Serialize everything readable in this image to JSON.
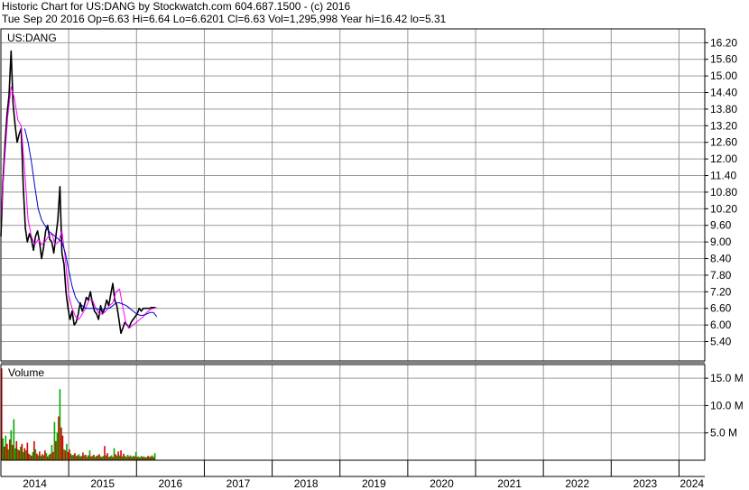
{
  "header": {
    "line1": "Historic Chart for US:DANG by Stockwatch.com 604.687.1500 - (c) 2016",
    "line2": "Tue Sep 20 2016  Op=6.63  Hi=6.64  Lo=6.6201  Cl=6.63  Vol=1,295,998  Year hi=16.42  lo=5.31"
  },
  "colors": {
    "price": "#000000",
    "ma_fast": "#ff00ff",
    "ma_slow": "#0000cc",
    "vol_up": "#00aa00",
    "vol_down": "#dd0000",
    "grid": "#999999"
  },
  "chart_data": [
    {
      "type": "line",
      "title": "US:DANG",
      "ylim": [
        4.7,
        16.7
      ],
      "yticks": [
        "16.20",
        "15.60",
        "15.00",
        "14.40",
        "13.80",
        "13.20",
        "12.60",
        "12.00",
        "11.40",
        "10.80",
        "10.20",
        "9.60",
        "9.00",
        "8.40",
        "7.80",
        "7.20",
        "6.60",
        "6.00",
        "5.40"
      ],
      "xlim": [
        2014.0,
        2024.38
      ],
      "x_labels": [
        {
          "x": 2014.0,
          "label": "2014"
        },
        {
          "x": 2015.0,
          "label": "2015"
        },
        {
          "x": 2016.0,
          "label": "2016"
        },
        {
          "x": 2017.0,
          "label": "2017"
        },
        {
          "x": 2018.0,
          "label": "2018"
        },
        {
          "x": 2019.0,
          "label": "2019"
        },
        {
          "x": 2020.0,
          "label": "2020"
        },
        {
          "x": 2021.0,
          "label": "2021"
        },
        {
          "x": 2022.0,
          "label": "2022"
        },
        {
          "x": 2023.0,
          "label": "2023"
        },
        {
          "x": 2024.0,
          "label": "2024"
        }
      ],
      "series": [
        {
          "key": "price",
          "x": [
            2014.0,
            2014.03,
            2014.06,
            2014.09,
            2014.12,
            2014.15,
            2014.18,
            2014.21,
            2014.24,
            2014.27,
            2014.3,
            2014.33,
            2014.36,
            2014.39,
            2014.42,
            2014.45,
            2014.48,
            2014.51,
            2014.54,
            2014.57,
            2014.6,
            2014.63,
            2014.66,
            2014.69,
            2014.72,
            2014.75,
            2014.78,
            2014.81,
            2014.84,
            2014.87,
            2014.9,
            2014.93,
            2014.96,
            2014.99,
            2015.02,
            2015.05,
            2015.08,
            2015.11,
            2015.14,
            2015.17,
            2015.2,
            2015.23,
            2015.26,
            2015.29,
            2015.32,
            2015.35,
            2015.38,
            2015.41,
            2015.44,
            2015.47,
            2015.5,
            2015.53,
            2015.56,
            2015.59,
            2015.62,
            2015.65,
            2015.68,
            2015.71,
            2015.74,
            2015.77,
            2015.8,
            2015.83,
            2015.86,
            2015.89,
            2015.92,
            2015.95,
            2015.98,
            2016.01,
            2016.04,
            2016.07,
            2016.1,
            2016.13,
            2016.16,
            2016.19,
            2016.22,
            2016.25,
            2016.28
          ],
          "y": [
            9.2,
            11.2,
            12.5,
            13.6,
            14.3,
            15.9,
            14.0,
            13.2,
            12.6,
            12.9,
            13.1,
            11.0,
            9.5,
            9.0,
            9.3,
            9.1,
            8.7,
            9.2,
            9.4,
            9.0,
            8.4,
            8.8,
            9.4,
            9.6,
            9.1,
            9.0,
            8.6,
            9.2,
            9.8,
            11.0,
            8.6,
            8.2,
            7.2,
            6.6,
            6.2,
            6.5,
            6.0,
            6.1,
            6.4,
            6.8,
            6.5,
            6.7,
            7.0,
            6.9,
            7.2,
            6.8,
            6.5,
            6.4,
            6.2,
            6.7,
            6.4,
            6.6,
            6.9,
            6.7,
            7.1,
            7.5,
            6.9,
            6.7,
            6.2,
            5.7,
            5.9,
            6.1,
            6.0,
            5.9,
            6.1,
            6.2,
            6.3,
            6.4,
            6.6,
            6.5,
            6.6,
            6.6,
            6.6,
            6.6,
            6.63,
            6.63,
            6.63
          ]
        },
        {
          "key": "ma_fast",
          "x": [
            2014.0,
            2014.05,
            2014.1,
            2014.15,
            2014.2,
            2014.25,
            2014.3,
            2014.35,
            2014.4,
            2014.45,
            2014.5,
            2014.55,
            2014.6,
            2014.65,
            2014.7,
            2014.75,
            2014.8,
            2014.85,
            2014.9,
            2014.95,
            2015.0,
            2015.05,
            2015.1,
            2015.15,
            2015.2,
            2015.25,
            2015.3,
            2015.35,
            2015.4,
            2015.45,
            2015.5,
            2015.55,
            2015.6,
            2015.65,
            2015.7,
            2015.75,
            2015.8,
            2015.85,
            2015.9,
            2015.95,
            2016.0,
            2016.05,
            2016.1,
            2016.15,
            2016.2,
            2016.25,
            2016.3
          ],
          "y": [
            9.8,
            11.8,
            13.5,
            14.6,
            14.2,
            13.4,
            13.2,
            11.6,
            9.8,
            9.2,
            8.9,
            9.1,
            8.9,
            9.0,
            9.2,
            9.3,
            8.9,
            9.0,
            9.4,
            8.4,
            7.1,
            6.6,
            6.3,
            6.2,
            6.4,
            6.6,
            6.9,
            6.9,
            6.6,
            6.4,
            6.4,
            6.5,
            6.7,
            6.8,
            7.2,
            7.3,
            6.6,
            6.0,
            5.9,
            6.0,
            6.1,
            6.2,
            6.3,
            6.45,
            6.55,
            6.6,
            6.63
          ]
        },
        {
          "key": "ma_slow",
          "x": [
            2014.35,
            2014.4,
            2014.45,
            2014.5,
            2014.55,
            2014.6,
            2014.65,
            2014.7,
            2014.75,
            2014.8,
            2014.85,
            2014.9,
            2014.95,
            2015.0,
            2015.05,
            2015.1,
            2015.15,
            2015.2,
            2015.25,
            2015.3,
            2015.35,
            2015.4,
            2015.45,
            2015.5,
            2015.55,
            2015.6,
            2015.65,
            2015.7,
            2015.75,
            2015.8,
            2015.85,
            2015.9,
            2015.95,
            2016.0,
            2016.05,
            2016.1,
            2016.15,
            2016.2,
            2016.25,
            2016.3
          ],
          "y": [
            13.1,
            12.6,
            11.9,
            11.0,
            10.2,
            9.8,
            9.6,
            9.4,
            9.3,
            9.2,
            9.1,
            9.0,
            8.6,
            8.0,
            7.4,
            7.0,
            6.8,
            6.7,
            6.6,
            6.6,
            6.6,
            6.6,
            6.55,
            6.55,
            6.6,
            6.6,
            6.7,
            6.8,
            6.8,
            6.75,
            6.7,
            6.6,
            6.5,
            6.4,
            6.35,
            6.35,
            6.4,
            6.45,
            6.45,
            6.3
          ]
        }
      ]
    },
    {
      "type": "bar",
      "title": "Volume",
      "ylim": [
        0,
        17.5
      ],
      "yticks": [
        "15.0 M",
        "10.0 M",
        "5.0 M"
      ],
      "xlim": [
        2014.0,
        2024.38
      ],
      "x": [
        2014.0,
        2014.02,
        2014.04,
        2014.06,
        2014.08,
        2014.1,
        2014.12,
        2014.14,
        2014.16,
        2014.18,
        2014.2,
        2014.22,
        2014.24,
        2014.26,
        2014.28,
        2014.3,
        2014.32,
        2014.34,
        2014.36,
        2014.38,
        2014.4,
        2014.42,
        2014.44,
        2014.46,
        2014.48,
        2014.5,
        2014.52,
        2014.54,
        2014.56,
        2014.58,
        2014.6,
        2014.62,
        2014.64,
        2014.66,
        2014.68,
        2014.7,
        2014.72,
        2014.74,
        2014.76,
        2014.78,
        2014.8,
        2014.82,
        2014.84,
        2014.86,
        2014.88,
        2014.9,
        2014.92,
        2014.94,
        2014.96,
        2014.98,
        2015.0,
        2015.02,
        2015.04,
        2015.06,
        2015.08,
        2015.1,
        2015.12,
        2015.14,
        2015.16,
        2015.18,
        2015.2,
        2015.22,
        2015.24,
        2015.26,
        2015.28,
        2015.3,
        2015.32,
        2015.34,
        2015.36,
        2015.38,
        2015.4,
        2015.42,
        2015.44,
        2015.46,
        2015.48,
        2015.5,
        2015.52,
        2015.54,
        2015.56,
        2015.58,
        2015.6,
        2015.62,
        2015.64,
        2015.66,
        2015.68,
        2015.7,
        2015.72,
        2015.74,
        2015.76,
        2015.78,
        2015.8,
        2015.82,
        2015.84,
        2015.86,
        2015.88,
        2015.9,
        2015.92,
        2015.94,
        2015.96,
        2015.98,
        2016.0,
        2016.02,
        2016.04,
        2016.06,
        2016.08,
        2016.1,
        2016.12,
        2016.14,
        2016.16,
        2016.18,
        2016.2,
        2016.22,
        2016.24,
        2016.26
      ],
      "values": [
        16.8,
        4.0,
        2.5,
        4.5,
        3.0,
        2.0,
        3.8,
        5.5,
        2.8,
        7.5,
        2.2,
        3.5,
        2.0,
        1.8,
        2.5,
        3.0,
        1.5,
        2.2,
        1.8,
        3.2,
        1.2,
        1.0,
        0.8,
        1.5,
        3.5,
        2.0,
        1.2,
        0.9,
        1.6,
        0.8,
        1.1,
        0.9,
        1.8,
        1.3,
        0.7,
        1.0,
        1.2,
        2.8,
        1.5,
        7.0,
        3.5,
        5.0,
        8.0,
        13.0,
        6.0,
        4.5,
        2.0,
        1.8,
        3.0,
        1.5,
        2.0,
        1.2,
        0.9,
        1.0,
        1.3,
        0.8,
        0.9,
        1.1,
        0.7,
        0.8,
        1.4,
        0.9,
        1.0,
        0.6,
        0.9,
        1.8,
        0.7,
        0.8,
        1.0,
        0.6,
        0.8,
        0.9,
        1.1,
        0.7,
        0.6,
        0.8,
        2.6,
        0.9,
        1.3,
        0.6,
        0.7,
        0.9,
        0.6,
        2.2,
        1.1,
        0.8,
        1.6,
        0.9,
        1.8,
        0.7,
        1.2,
        0.8,
        0.6,
        1.0,
        0.7,
        0.9,
        0.6,
        0.8,
        0.7,
        1.5,
        0.6,
        0.7,
        0.5,
        0.8,
        0.6,
        0.7,
        0.5,
        0.6,
        0.8,
        0.6,
        0.7,
        0.9,
        0.6,
        1.3
      ],
      "up": [
        0,
        1,
        0,
        1,
        0,
        1,
        0,
        1,
        0,
        1,
        1,
        0,
        1,
        0,
        1,
        0,
        1,
        0,
        1,
        0,
        0,
        1,
        0,
        1,
        0,
        1,
        0,
        1,
        0,
        1,
        0,
        1,
        0,
        1,
        0,
        1,
        0,
        1,
        0,
        1,
        0,
        1,
        0,
        1,
        0,
        0,
        1,
        0,
        1,
        0,
        0,
        1,
        0,
        1,
        0,
        1,
        0,
        1,
        0,
        1,
        0,
        1,
        0,
        1,
        0,
        1,
        0,
        1,
        0,
        1,
        0,
        1,
        0,
        1,
        0,
        1,
        0,
        1,
        0,
        1,
        0,
        1,
        0,
        1,
        0,
        1,
        0,
        1,
        0,
        1,
        0,
        1,
        0,
        1,
        0,
        1,
        0,
        1,
        0,
        1,
        0,
        1,
        0,
        1,
        0,
        1,
        0,
        1,
        0,
        1,
        0,
        1,
        0,
        1
      ]
    }
  ]
}
